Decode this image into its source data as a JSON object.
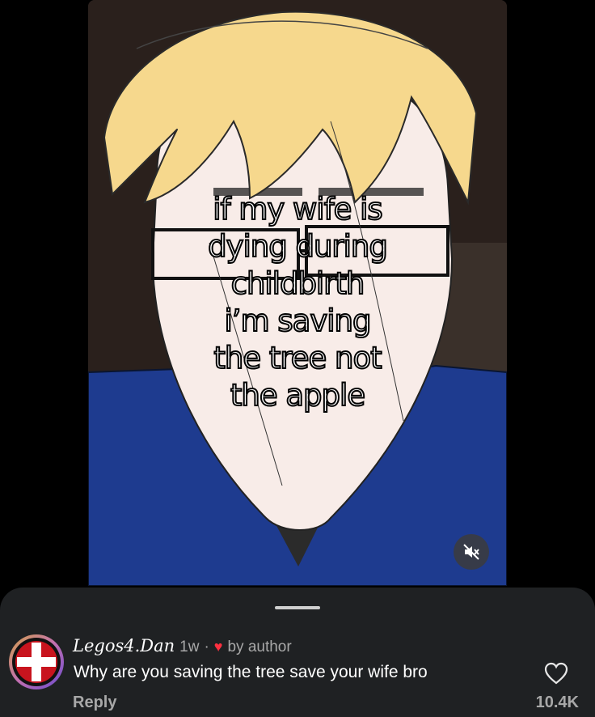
{
  "video": {
    "caption_lines": [
      "if my wife is",
      "dying during",
      "childbirth",
      "i’m saving",
      "the tree not",
      "the apple"
    ],
    "mute_icon": "speaker-muted-icon",
    "colors": {
      "hair": "#f6d88d",
      "shirt": "#1e3b8f",
      "skin": "#f8ece8"
    }
  },
  "comment": {
    "avatar_icon": "red-cross-flag-icon",
    "username": "Legos4.Dan",
    "age": "1w",
    "separator": "·",
    "heart": "♥",
    "liked_by": "by author",
    "text": "Why are you saving the tree save your wife bro",
    "reply_label": "Reply",
    "like_icon": "heart-outline-icon",
    "like_count": "10.4K"
  }
}
